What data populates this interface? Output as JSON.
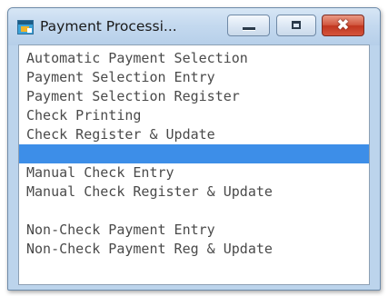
{
  "window": {
    "title": "Payment Processi...",
    "app_icon": "app-icon",
    "controls": {
      "minimize": "minimize-icon",
      "maximize": "maximize-icon",
      "close": "✖"
    }
  },
  "menu": {
    "selected_index": 5,
    "items": [
      "Automatic Payment Selection",
      "Payment Selection Entry",
      "Payment Selection Register",
      "Check Printing",
      "Check Register & Update",
      "",
      "Manual Check Entry",
      "Manual Check Register & Update",
      "",
      "Non-Check Payment Entry",
      "Non-Check Payment Reg & Update"
    ]
  },
  "colors": {
    "selection": "#3d8ee8",
    "frame": "#bcd4ec",
    "text": "#4a4a4a",
    "close_button": "#c1361f"
  }
}
